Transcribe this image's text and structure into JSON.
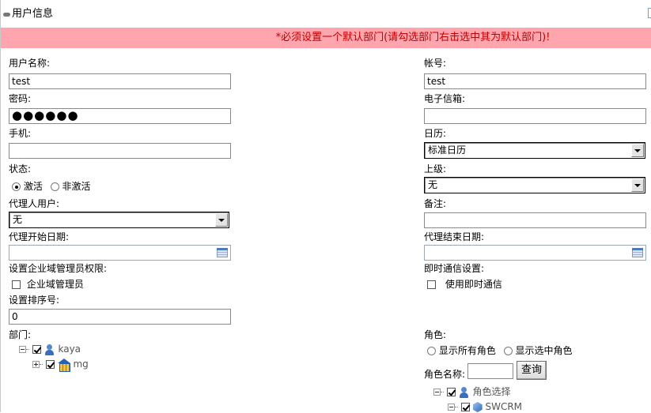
{
  "header": {
    "title": "用户信息"
  },
  "banner": {
    "text": "*必须设置一个默认部门(请勾选部门右击选中其为默认部门)!"
  },
  "left": {
    "username": {
      "label": "用户名称:",
      "value": "test"
    },
    "password": {
      "label": "密码:",
      "value": "●●●●●●"
    },
    "mobile": {
      "label": "手机:",
      "value": ""
    },
    "status": {
      "label": "状态:",
      "options": [
        "激活",
        "非激活"
      ],
      "selected": "激活"
    },
    "proxy_user": {
      "label": "代理人用户:",
      "value": "无"
    },
    "proxy_start": {
      "label": "代理开始日期:",
      "value": ""
    },
    "admin_perm": {
      "label": "设置企业域管理员权限:",
      "checkbox_label": "企业域管理员",
      "checked": false
    },
    "sort_no": {
      "label": "设置排序号:",
      "value": "0"
    },
    "dept": {
      "label": "部门:",
      "tree": [
        {
          "label": "kaya",
          "checked": true,
          "expanded": true
        },
        {
          "label": "mg",
          "checked": true,
          "expanded": false
        }
      ]
    }
  },
  "right": {
    "account": {
      "label": "帐号:",
      "value": "test"
    },
    "email": {
      "label": "电子信箱:",
      "value": ""
    },
    "calendar": {
      "label": "日历:",
      "value": "标准日历"
    },
    "superior": {
      "label": "上级:",
      "value": "无"
    },
    "remark": {
      "label": "备注:",
      "value": ""
    },
    "proxy_end": {
      "label": "代理结束日期:",
      "value": ""
    },
    "im": {
      "label": "即时通信设置:",
      "checkbox_label": "使用即时通信",
      "checked": false
    },
    "role": {
      "label": "角色:",
      "options": [
        "显示所有角色",
        "显示选中角色"
      ],
      "selected": null,
      "name_label": "角色名称:",
      "name_value": "",
      "query_button": "查询",
      "tree": [
        {
          "label": "角色选择",
          "checked": true,
          "expanded": true
        },
        {
          "label": "SWCRM",
          "checked": true,
          "expanded": true
        }
      ]
    }
  },
  "colors": {
    "banner_bg": "#ffa5ad",
    "banner_text": "#c00000"
  }
}
